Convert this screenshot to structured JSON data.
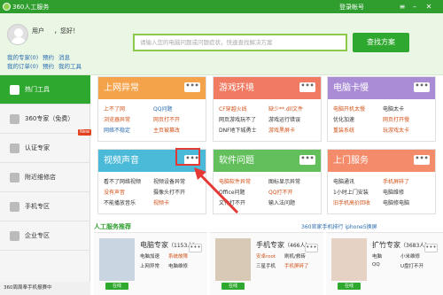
{
  "titlebar": {
    "title": "360人工服务",
    "login": "登录帐号"
  },
  "user": {
    "name": "用户",
    "greeting": "，您好！",
    "links": [
      "我的专家(0)",
      "预约",
      "消息",
      "我的订单(0)",
      "预约",
      "我的工具"
    ]
  },
  "search": {
    "placeholder": "请输入您的电脑问题或问题症状，快速查找解决方案",
    "button": "查找方案"
  },
  "sidebar": {
    "items": [
      "热门工具",
      "360专家（免费）",
      "认证专家",
      "附近维修店",
      "手机专区",
      "企业专区"
    ],
    "badge": "New",
    "footer": "360周周奉手机报赛中"
  },
  "cards": [
    {
      "title": "上网异常",
      "color": "#f5a34a",
      "links": [
        "上不了网",
        "QQ问题",
        "浏览器异常",
        "网页打不开",
        "网络不稳定",
        "主页被篡改"
      ]
    },
    {
      "title": "游戏环境",
      "color": "#f07a62",
      "links": [
        "CF穿越火线",
        "缺少**.dll文件",
        "网页游戏玩不了",
        "游戏运行错误",
        "DNF地下城勇士",
        "游戏黑屏卡"
      ]
    },
    {
      "title": "电脑卡慢",
      "color": "#a98bd6",
      "links": [
        "电脑开机太慢",
        "电脑太卡",
        "优化加速",
        "网页打开慢",
        "重装系统",
        "玩游戏太卡"
      ]
    },
    {
      "title": "视频声音",
      "color": "#4bb9d8",
      "links": [
        "看不了网络视频",
        "视频设备异常",
        "没有声音",
        "摄像头打不开",
        "不能播放音乐",
        "视频卡"
      ]
    },
    {
      "title": "软件问题",
      "color": "#62bf5c",
      "links": [
        "电脑软件异常",
        "图标显示异常",
        "Office问题",
        "QQ打不开",
        "文件打不开",
        "输入法问题"
      ]
    },
    {
      "title": "上门服务",
      "color": "#f48b6b",
      "links": [
        "电脑通讯",
        "手机屏碎了",
        "1小时上门安装",
        "电脑维修",
        "旧手机高价回收",
        "电脑修电脑"
      ]
    }
  ],
  "services": {
    "title": "人工服务推荐",
    "right_text": "360官家手机排行",
    "right_link": "iphone5换屏",
    "experts": [
      {
        "name": "电脑专家",
        "count": "（1153人）",
        "online": "在线",
        "lines": [
          "电脑加速",
          "系统故障",
          "上网异常",
          "电脑维修"
        ]
      },
      {
        "name": "手机专家",
        "count": "（466人）",
        "online": "在线",
        "lines": [
          "安卓root",
          "刷机/救砖",
          "三星手机",
          "手机屏碎了"
        ]
      },
      {
        "name": "扩竹专家",
        "count": "（3683人）",
        "online": "在线",
        "lines": [
          "电脑",
          "小米维修",
          "QQ",
          "U盘打不开"
        ]
      }
    ]
  },
  "more_icon": "•••"
}
